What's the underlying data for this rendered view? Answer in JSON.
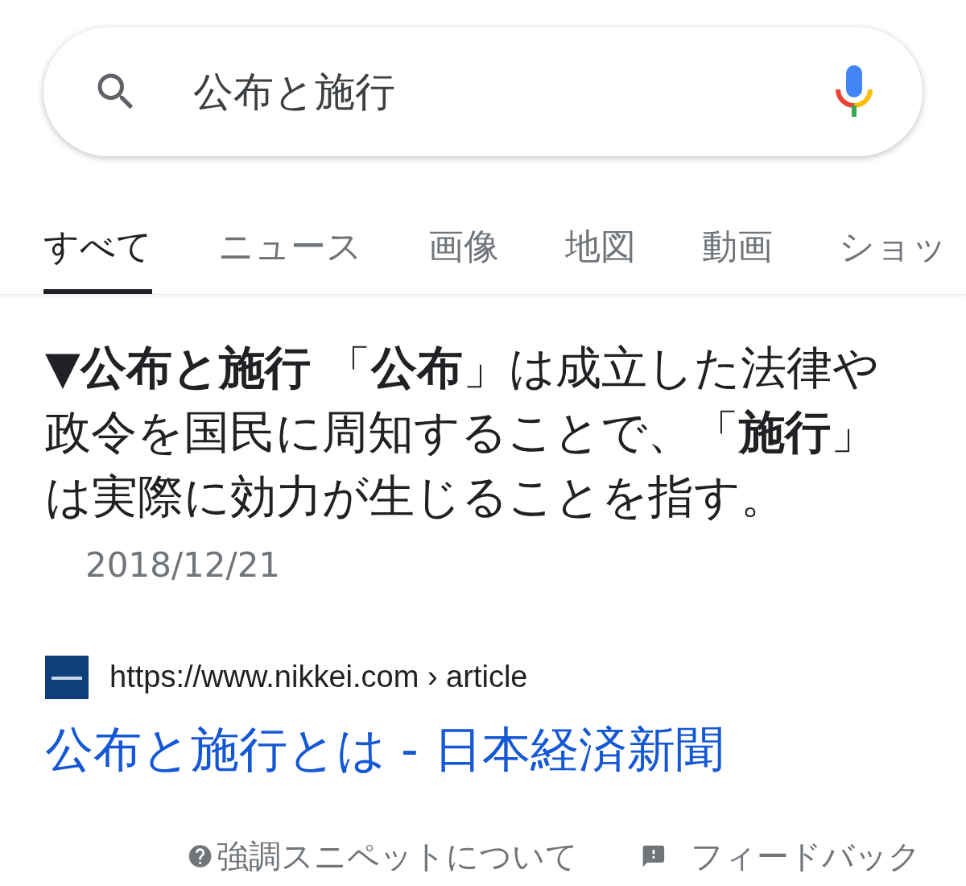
{
  "search": {
    "value": "公布と施行"
  },
  "tabs": [
    {
      "label": "すべて",
      "selected": true
    },
    {
      "label": "ニュース",
      "selected": false
    },
    {
      "label": "画像",
      "selected": false
    },
    {
      "label": "地図",
      "selected": false
    },
    {
      "label": "動画",
      "selected": false
    },
    {
      "label": "ショッ",
      "selected": false
    }
  ],
  "snippet": {
    "text": "**▼公布と施行** 「**公布**」は成立した法律や政令を国民に周知することで、「**施行**」は実際に効力が生じることを指す。",
    "date": "2018/12/21"
  },
  "result": {
    "url": "https://www.nikkei.com › article",
    "title": "公布と施行とは - 日本経済新聞"
  },
  "footer": {
    "about": "強調スニペットについて",
    "feedback": "フィードバック"
  }
}
